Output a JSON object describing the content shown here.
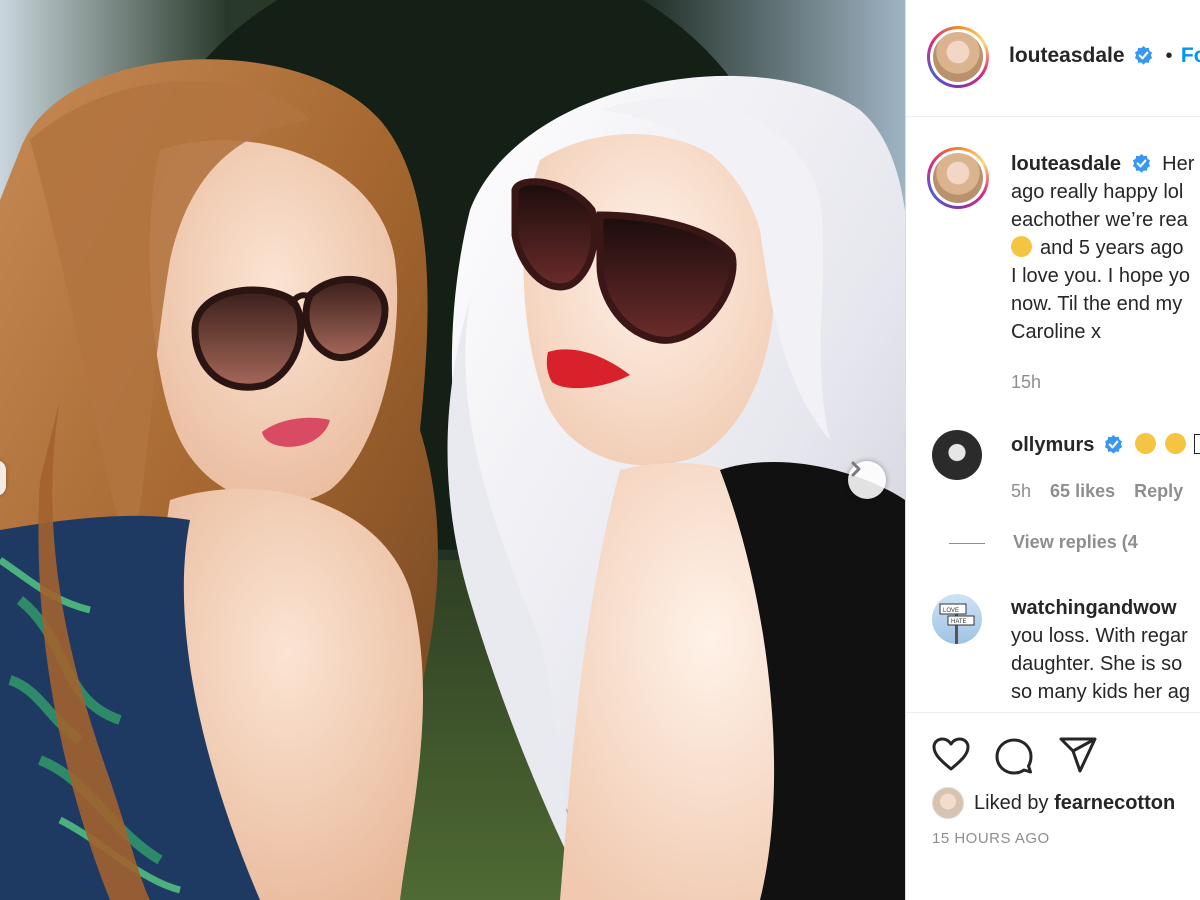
{
  "post": {
    "username": "louteasdale",
    "follow_label": "Fo",
    "separator": "•"
  },
  "caption": {
    "lines": [
      "Her",
      "ago really happy lol",
      "eachother we’re rea",
      "and 5 years ago",
      "I love you. I hope yo",
      "now. Til the end my",
      "Caroline x"
    ],
    "time": "15h"
  },
  "comments": [
    {
      "username": "ollymurs",
      "time": "5h",
      "likes": "65 likes",
      "reply": "Reply",
      "view_replies": "View replies (4"
    },
    {
      "username": "watchingandwow",
      "lines": [
        "you loss. With regar",
        "daughter. She is so",
        "so many kids her ag"
      ],
      "avatar_sign_top": "LOVE",
      "avatar_sign_bottom": "HATE"
    }
  ],
  "footer": {
    "liked_by_prefix": "Liked by ",
    "liked_by_user": "fearnecotton",
    "timestamp": "15 HOURS AGO"
  },
  "colors": {
    "link_blue": "#0095f6",
    "verified_blue": "#3897f0",
    "muted_text": "#8e8e8e",
    "primary_text": "#262626",
    "lipstick": "#d8212a"
  },
  "icons": [
    "heart-icon",
    "comment-icon",
    "share-icon",
    "chevron-right-icon",
    "verified-badge-icon"
  ]
}
